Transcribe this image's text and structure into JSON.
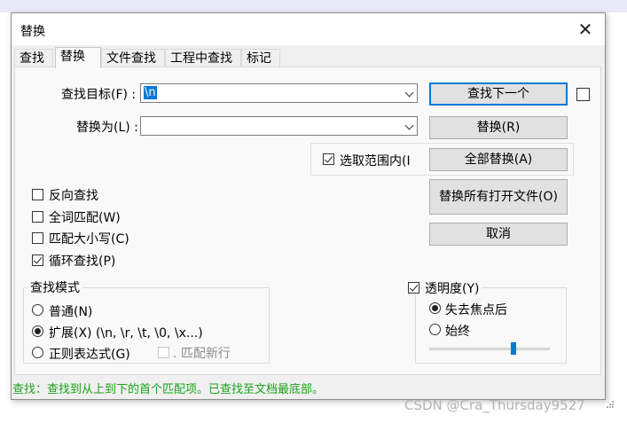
{
  "dialog": {
    "title": "替换",
    "close_glyph": "✕"
  },
  "tabs": [
    {
      "label": "查找"
    },
    {
      "label": "替换"
    },
    {
      "label": "文件查找"
    },
    {
      "label": "工程中查找"
    },
    {
      "label": "标记"
    }
  ],
  "find": {
    "label": "查找目标(F) :",
    "value": "\\n"
  },
  "replace": {
    "label": "替换为(L) :",
    "value": ""
  },
  "in_selection": {
    "label": "选取范围内(I",
    "checked": true
  },
  "buttons": {
    "find_next": "查找下一个",
    "replace": "替换(R)",
    "replace_all": "全部替换(A)",
    "replace_all_open": "替换所有打开文件(O)",
    "cancel": "取消"
  },
  "options": [
    {
      "label": "反向查找",
      "checked": false
    },
    {
      "label": "全词匹配(W)",
      "checked": false
    },
    {
      "label": "匹配大小写(C)",
      "checked": false
    },
    {
      "label": "循环查找(P)",
      "checked": true
    }
  ],
  "search_mode": {
    "title": "查找模式",
    "normal": "普通(N)",
    "extended": "扩展(X) (\\n, \\r, \\t, \\0, \\x...)",
    "regex": "正则表达式(G)",
    "dot_newline": ". 匹配新行",
    "selected": "extended"
  },
  "transparency": {
    "label": "透明度(Y)",
    "checked": true,
    "on_lose_focus": "失去焦点后",
    "always": "始终",
    "selected": "on_lose_focus",
    "level": 0.7
  },
  "status": "查找：查找到从上到下的首个匹配项。已查找至文档最底部。",
  "watermark": "CSDN @Cra_Thursday9527",
  "colors": {
    "accent": "#0078d7",
    "status_text": "#1aa31a"
  }
}
